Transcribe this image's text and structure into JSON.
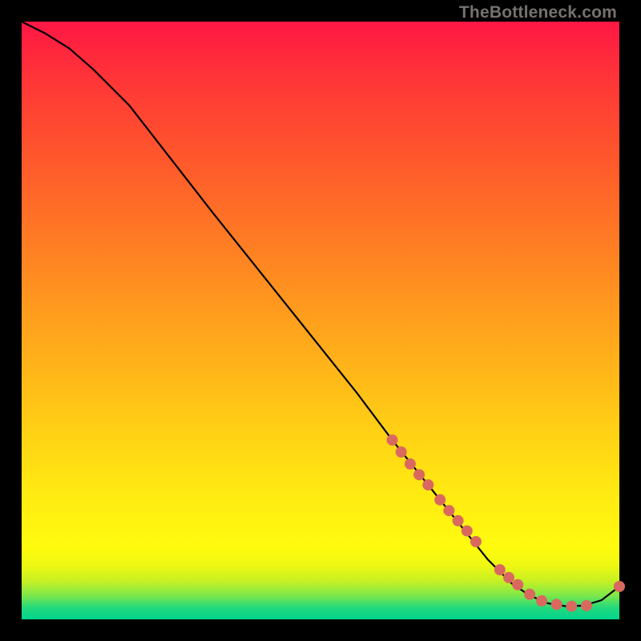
{
  "watermark": "TheBottleneck.com",
  "chart_data": {
    "type": "line",
    "title": "",
    "xlabel": "",
    "ylabel": "",
    "xlim": [
      0,
      100
    ],
    "ylim": [
      0,
      100
    ],
    "grid": false,
    "line": {
      "name": "curve",
      "x": [
        0,
        4,
        8,
        12,
        18,
        25,
        32,
        40,
        48,
        56,
        62,
        68,
        74,
        78,
        82,
        85,
        88,
        91,
        94,
        97,
        100
      ],
      "y": [
        100,
        98,
        95.5,
        92,
        86,
        77,
        68,
        58,
        48,
        38,
        30,
        22.5,
        15,
        10,
        6,
        4,
        2.7,
        2.2,
        2.3,
        3.2,
        5.5
      ]
    },
    "markers": {
      "name": "highlight-points",
      "color": "#d9695e",
      "x": [
        62,
        63.5,
        65,
        66.5,
        68,
        70,
        71.5,
        73,
        74.5,
        76,
        80,
        81.5,
        83,
        85,
        87,
        89.5,
        92,
        94.5,
        100
      ],
      "y": [
        30,
        28,
        26,
        24.2,
        22.5,
        20,
        18.2,
        16.5,
        14.8,
        13,
        8.3,
        7,
        5.8,
        4.2,
        3.1,
        2.5,
        2.2,
        2.3,
        5.5
      ]
    }
  }
}
